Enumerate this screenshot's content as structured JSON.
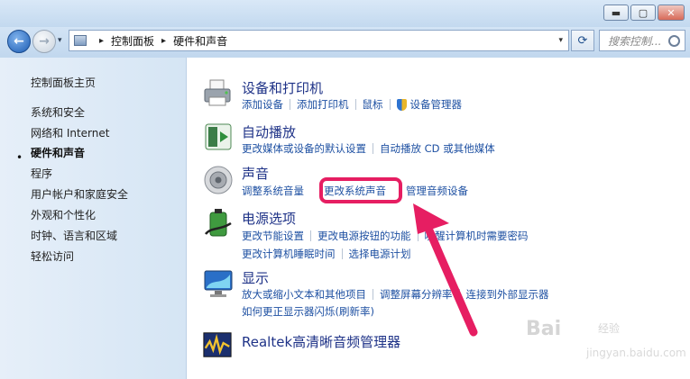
{
  "window": {
    "min_label": "▬",
    "max_label": "▢",
    "close_label": "✕"
  },
  "nav": {
    "breadcrumb": [
      "控制面板",
      "硬件和声音"
    ],
    "breadcrumb_sep": "▸",
    "dropdown_glyph": "▾",
    "search_placeholder": "搜索控制..."
  },
  "sidebar": {
    "items": [
      {
        "label": "控制面板主页"
      },
      {
        "label": "系统和安全"
      },
      {
        "label": "网络和 Internet"
      },
      {
        "label": "硬件和声音",
        "current": true
      },
      {
        "label": "程序"
      },
      {
        "label": "用户帐户和家庭安全"
      },
      {
        "label": "外观和个性化"
      },
      {
        "label": "时钟、语言和区域"
      },
      {
        "label": "轻松访问"
      }
    ],
    "bullet": "•"
  },
  "categories": [
    {
      "title": "设备和打印机",
      "icon": "printer-icon",
      "rows": [
        [
          "添加设备",
          "添加打印机",
          "鼠标",
          "设备管理器"
        ]
      ]
    },
    {
      "title": "自动播放",
      "icon": "autoplay-icon",
      "rows": [
        [
          "更改媒体或设备的默认设置",
          "自动播放 CD 或其他媒体"
        ]
      ]
    },
    {
      "title": "声音",
      "icon": "speaker-icon",
      "rows": [
        [
          "调整系统音量",
          "更改系统声音",
          "管理音频设备"
        ]
      ]
    },
    {
      "title": "电源选项",
      "icon": "battery-icon",
      "rows": [
        [
          "更改节能设置",
          "更改电源按钮的功能",
          "唤醒计算机时需要密码"
        ],
        [
          "更改计算机睡眠时间",
          "选择电源计划"
        ]
      ]
    },
    {
      "title": "显示",
      "icon": "monitor-icon",
      "rows": [
        [
          "放大或缩小文本和其他项目",
          "调整屏幕分辨率",
          "连接到外部显示器"
        ],
        [
          "如何更正显示器闪烁(刷新率)"
        ]
      ]
    },
    {
      "title": "Realtek高清晰音频管理器",
      "icon": "realtek-audio-icon",
      "rows": []
    }
  ],
  "annotation": {
    "highlight_color": "#e61e62"
  },
  "watermark": {
    "brand": "Bai",
    "brand2": "经验",
    "url": "jingyan.baidu.com"
  }
}
